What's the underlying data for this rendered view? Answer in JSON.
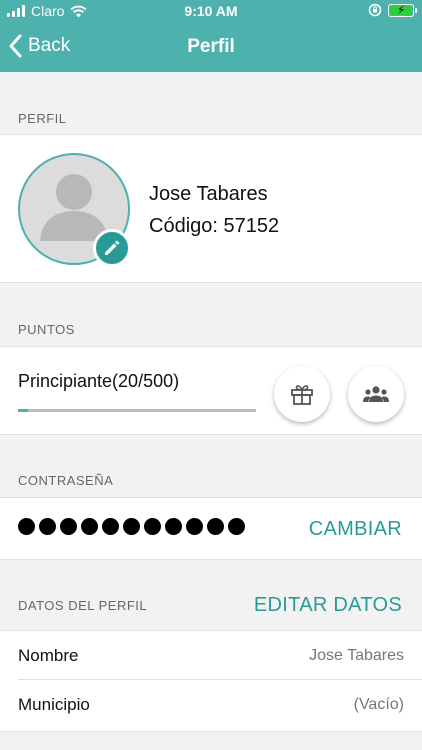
{
  "status_bar": {
    "carrier": "Claro",
    "time": "9:10 AM"
  },
  "nav": {
    "back_label": "Back",
    "title": "Perfil"
  },
  "profile": {
    "section_label": "PERFIL",
    "name": "Jose Tabares",
    "code": "Código: 57152"
  },
  "points": {
    "section_label": "PUNTOS",
    "level_text": "Principiante(20/500)",
    "current": 20,
    "max": 500,
    "progress_fraction": 0.04
  },
  "password": {
    "section_label": "CONTRASEÑA",
    "masked_dots": 11,
    "change_label": "CAMBIAR"
  },
  "profile_data": {
    "section_label": "DATOS DEL PERFIL",
    "edit_label": "EDITAR DATOS",
    "rows": [
      {
        "label": "Nombre",
        "value": "Jose Tabares"
      },
      {
        "label": "Municipio",
        "value": "(Vacío)"
      }
    ]
  },
  "colors": {
    "accent": "#4db1ad",
    "accent_dark": "#2a9a96"
  },
  "icons": [
    "wifi-icon",
    "rotation-lock-icon",
    "battery-icon",
    "back-chevron-icon",
    "pencil-icon",
    "gift-icon",
    "group-icon"
  ]
}
